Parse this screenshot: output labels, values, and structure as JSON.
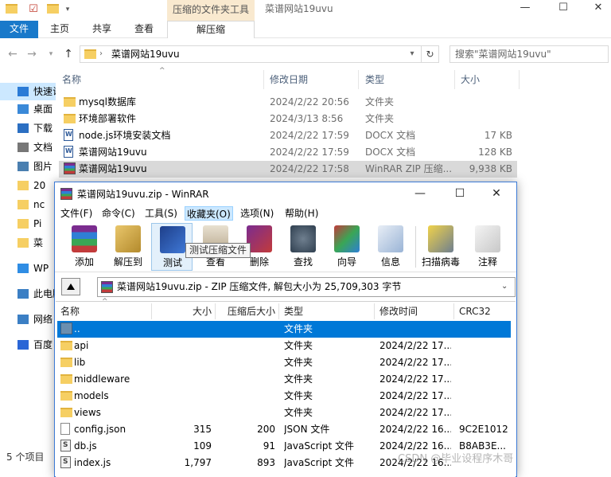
{
  "explorer": {
    "context_tab_group": "压缩的文件夹工具",
    "window_title": "菜谱网站19uvu",
    "ribbon_tabs": {
      "file": "文件",
      "home": "主页",
      "share": "共享",
      "view": "查看",
      "extract": "解压缩"
    },
    "address_path": "菜谱网站19uvu",
    "search_placeholder": "搜索\"菜谱网站19uvu\"",
    "columns": {
      "name": "名称",
      "date": "修改日期",
      "type": "类型",
      "size": "大小"
    },
    "files": [
      {
        "name": "mysql数据库",
        "date": "2024/2/22 20:56",
        "type": "文件夹",
        "size": "",
        "icon": "folder-icon"
      },
      {
        "name": "环境部署软件",
        "date": "2024/3/13 8:56",
        "type": "文件夹",
        "size": "",
        "icon": "folder-icon"
      },
      {
        "name": "node.js环境安装文档",
        "date": "2024/2/22 17:59",
        "type": "DOCX 文档",
        "size": "17 KB",
        "icon": "word-doc-icon"
      },
      {
        "name": "菜谱网站19uvu",
        "date": "2024/2/22 17:59",
        "type": "DOCX 文档",
        "size": "128 KB",
        "icon": "word-doc-icon"
      },
      {
        "name": "菜谱网站19uvu",
        "date": "2024/2/22 17:58",
        "type": "WinRAR ZIP 压缩...",
        "size": "9,938 KB",
        "icon": "winrar-archive-icon"
      }
    ],
    "nav_items": [
      {
        "label": "快速访问",
        "icon": "star-icon"
      },
      {
        "label": "桌面",
        "icon": "desktop-icon"
      },
      {
        "label": "下载",
        "icon": "download-icon"
      },
      {
        "label": "文档",
        "icon": "document-icon"
      },
      {
        "label": "图片",
        "icon": "picture-icon"
      },
      {
        "label": "20",
        "icon": "folder-icon"
      },
      {
        "label": "nc",
        "icon": "folder-icon"
      },
      {
        "label": "Pi",
        "icon": "folder-icon"
      },
      {
        "label": "菜",
        "icon": "folder-icon"
      },
      {
        "label": "WP",
        "icon": "cloud-icon"
      },
      {
        "label": "此电脑",
        "icon": "computer-icon"
      },
      {
        "label": "网络",
        "icon": "network-icon"
      },
      {
        "label": "百度",
        "icon": "baidu-icon"
      }
    ],
    "status": "5 个项目"
  },
  "winrar": {
    "title": "菜谱网站19uvu.zip - WinRAR",
    "menu": [
      "文件(F)",
      "命令(C)",
      "工具(S)",
      "收藏夹(O)",
      "选项(N)",
      "帮助(H)"
    ],
    "toolbar": [
      {
        "label": "添加",
        "icon": "add-archive-icon"
      },
      {
        "label": "解压到",
        "icon": "extract-to-icon"
      },
      {
        "label": "测试",
        "icon": "test-archive-icon"
      },
      {
        "label": "查看",
        "icon": "view-icon"
      },
      {
        "label": "删除",
        "icon": "delete-icon"
      },
      {
        "label": "查找",
        "icon": "find-icon"
      },
      {
        "label": "向导",
        "icon": "wizard-icon"
      },
      {
        "label": "信息",
        "icon": "info-icon"
      },
      {
        "label": "扫描病毒",
        "icon": "virus-scan-icon"
      },
      {
        "label": "注释",
        "icon": "comment-icon"
      }
    ],
    "tooltip": "测试压缩文件",
    "path": "菜谱网站19uvu.zip - ZIP 压缩文件, 解包大小为 25,709,303 字节",
    "columns": {
      "name": "名称",
      "size": "大小",
      "packed": "压缩后大小",
      "type": "类型",
      "modified": "修改时间",
      "crc": "CRC32"
    },
    "entries": [
      {
        "name": "..",
        "size": "",
        "packed": "",
        "type": "文件夹",
        "modified": "",
        "crc": "",
        "icon": "parent-folder-icon"
      },
      {
        "name": "api",
        "size": "",
        "packed": "",
        "type": "文件夹",
        "modified": "2024/2/22 17...",
        "crc": "",
        "icon": "folder-icon"
      },
      {
        "name": "lib",
        "size": "",
        "packed": "",
        "type": "文件夹",
        "modified": "2024/2/22 17...",
        "crc": "",
        "icon": "folder-icon"
      },
      {
        "name": "middleware",
        "size": "",
        "packed": "",
        "type": "文件夹",
        "modified": "2024/2/22 17...",
        "crc": "",
        "icon": "folder-icon"
      },
      {
        "name": "models",
        "size": "",
        "packed": "",
        "type": "文件夹",
        "modified": "2024/2/22 17...",
        "crc": "",
        "icon": "folder-icon"
      },
      {
        "name": "views",
        "size": "",
        "packed": "",
        "type": "文件夹",
        "modified": "2024/2/22 17...",
        "crc": "",
        "icon": "folder-icon"
      },
      {
        "name": "config.json",
        "size": "315",
        "packed": "200",
        "type": "JSON 文件",
        "modified": "2024/2/22 16...",
        "crc": "9C2E1012",
        "icon": "json-file-icon"
      },
      {
        "name": "db.js",
        "size": "109",
        "packed": "91",
        "type": "JavaScript 文件",
        "modified": "2024/2/22 16...",
        "crc": "B8AB3E...",
        "icon": "js-file-icon"
      },
      {
        "name": "index.js",
        "size": "1,797",
        "packed": "893",
        "type": "JavaScript 文件",
        "modified": "2024/2/22 16...",
        "crc": "",
        "icon": "js-file-icon"
      }
    ]
  },
  "watermark": "CSDN @毕业设程序木哥",
  "colors": {
    "accent": "#0078d7",
    "file_tab": "#1979ca",
    "context_tab": "#f9e9cf",
    "selection": "#cce8ff"
  }
}
